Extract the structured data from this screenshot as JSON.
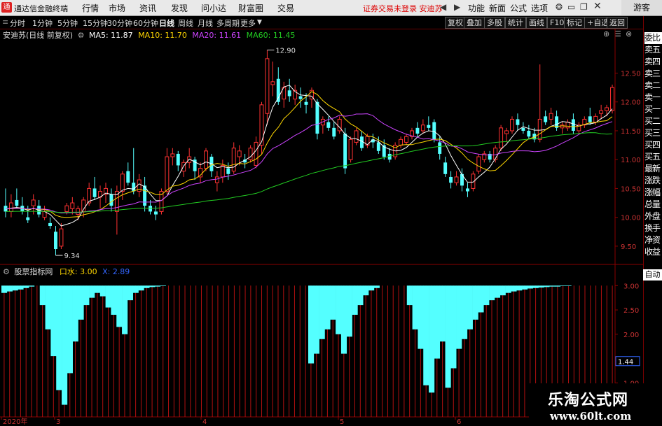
{
  "window": {
    "app_title": "通达信金融终端",
    "logo_glyph": "通",
    "guest": "游客"
  },
  "menu": [
    "行情",
    "市场",
    "资讯",
    "发现",
    "问小达",
    "财富圈",
    "交易"
  ],
  "notice": "证券交易未登录  安迪苏",
  "right_links": [
    "功能",
    "新面",
    "公式",
    "选项"
  ],
  "timeframes": [
    "分时",
    "1分钟",
    "5分钟",
    "15分钟",
    "30分钟",
    "60分钟",
    "日线",
    "周线",
    "月线",
    "多周期",
    "更多"
  ],
  "timeframe_active": "日线",
  "toolbar_buttons": [
    "复权",
    "叠加",
    "多股",
    "统计",
    "画线",
    "F10",
    "标记",
    "+自选",
    "返回"
  ],
  "price_legend": {
    "name": "安迪苏(日线 前复权)",
    "ma5": "MA5: 11.87",
    "ma10": "MA10: 11.70",
    "ma20": "MA20: 11.61",
    "ma60": "MA60: 11.45"
  },
  "indicator_legend": {
    "name": "股票指标网",
    "kou": "口水: 3.00",
    "x": "X: 2.89"
  },
  "right_panel": [
    "委比",
    "卖五",
    "卖四",
    "卖三",
    "卖二",
    "卖一",
    "买一",
    "买二",
    "买三",
    "买四",
    "买五",
    "最新",
    "涨跌",
    "涨幅",
    "总量",
    "外盘",
    "换手",
    "净资",
    "收益"
  ],
  "right_panel_auto": "自动",
  "current_value": "1.44",
  "colors": {
    "up": "#ff3232",
    "down": "#54ffff",
    "ma5": "#ffffff",
    "ma10": "#ffd700",
    "ma20": "#cc44ff",
    "ma60": "#22cc22",
    "grid": "#8a0000",
    "indicator": "#54ffff"
  },
  "watermark": {
    "cn": "乐淘公式网",
    "en": "www.60lt.com"
  },
  "chart_data": [
    {
      "type": "candlestick",
      "y_ticks": [
        9.5,
        10.0,
        10.5,
        11.0,
        11.5,
        12.0,
        12.5
      ],
      "ylim": [
        9.22,
        13.1
      ],
      "high_label": "12.90",
      "low_label": "9.34",
      "x_tick_labels": [
        "2020年",
        "3",
        "4",
        "5",
        "6"
      ],
      "candles": [
        [
          10.2,
          10.5,
          10.0,
          10.1
        ],
        [
          10.1,
          10.4,
          10.0,
          10.25
        ],
        [
          10.3,
          10.5,
          10.15,
          10.2
        ],
        [
          10.2,
          10.35,
          10.05,
          10.1
        ],
        [
          10.0,
          10.2,
          9.9,
          9.95
        ],
        [
          10.2,
          10.4,
          10.05,
          10.3
        ],
        [
          10.2,
          10.3,
          10.0,
          10.05
        ],
        [
          10.0,
          10.2,
          9.95,
          10.1
        ],
        [
          9.9,
          10.0,
          9.8,
          9.85
        ],
        [
          9.75,
          9.85,
          9.34,
          9.45
        ],
        [
          9.5,
          9.9,
          9.45,
          9.8
        ],
        [
          10.1,
          10.25,
          10.05,
          10.2
        ],
        [
          10.15,
          10.35,
          10.05,
          10.25
        ],
        [
          10.05,
          10.2,
          9.95,
          10.15
        ],
        [
          10.1,
          10.35,
          10.0,
          10.3
        ],
        [
          10.25,
          10.6,
          10.2,
          10.5
        ],
        [
          10.5,
          10.7,
          10.3,
          10.35
        ],
        [
          10.35,
          10.55,
          10.15,
          10.45
        ],
        [
          10.4,
          10.6,
          10.25,
          10.5
        ],
        [
          10.4,
          10.5,
          10.1,
          10.2
        ],
        [
          10.1,
          10.55,
          9.7,
          10.45
        ],
        [
          10.45,
          10.8,
          10.3,
          10.75
        ],
        [
          10.8,
          10.95,
          10.55,
          10.6
        ],
        [
          10.6,
          11.2,
          10.4,
          10.45
        ],
        [
          10.45,
          10.75,
          10.35,
          10.65
        ],
        [
          10.55,
          10.7,
          10.1,
          10.2
        ],
        [
          10.2,
          10.3,
          10.05,
          10.1
        ],
        [
          10.1,
          10.2,
          9.95,
          10.05
        ],
        [
          10.1,
          10.5,
          10.05,
          10.45
        ],
        [
          10.45,
          11.2,
          10.4,
          11.05
        ],
        [
          11.05,
          11.2,
          10.9,
          11.1
        ],
        [
          11.1,
          11.15,
          10.8,
          10.9
        ],
        [
          10.8,
          11.0,
          10.7,
          10.95
        ],
        [
          10.95,
          11.2,
          10.85,
          11.05
        ],
        [
          11.0,
          11.05,
          10.65,
          10.8
        ],
        [
          10.7,
          10.95,
          10.6,
          10.85
        ],
        [
          10.85,
          11.2,
          10.8,
          11.15
        ],
        [
          11.05,
          11.1,
          10.7,
          10.8
        ],
        [
          10.6,
          10.8,
          10.45,
          10.7
        ],
        [
          10.7,
          11.0,
          10.6,
          10.9
        ],
        [
          10.85,
          10.95,
          10.65,
          10.75
        ],
        [
          10.8,
          11.3,
          10.75,
          11.2
        ],
        [
          11.05,
          11.25,
          10.9,
          11.15
        ],
        [
          11.0,
          11.1,
          10.85,
          10.95
        ],
        [
          11.0,
          11.25,
          10.95,
          11.2
        ],
        [
          10.9,
          11.4,
          10.85,
          11.3
        ],
        [
          11.25,
          12.0,
          11.1,
          11.95
        ],
        [
          11.8,
          12.9,
          11.6,
          12.75
        ],
        [
          12.3,
          12.7,
          12.1,
          12.35
        ],
        [
          12.4,
          12.6,
          11.95,
          12.0
        ],
        [
          12.05,
          12.35,
          11.9,
          12.25
        ],
        [
          12.2,
          12.4,
          12.0,
          12.1
        ],
        [
          12.05,
          12.3,
          11.95,
          12.2
        ],
        [
          12.1,
          12.25,
          11.9,
          12.05
        ],
        [
          12.0,
          12.15,
          11.8,
          11.95
        ],
        [
          12.05,
          12.25,
          11.9,
          12.2
        ],
        [
          12.0,
          12.05,
          11.35,
          11.45
        ],
        [
          11.6,
          11.75,
          11.45,
          11.7
        ],
        [
          11.65,
          11.75,
          11.5,
          11.55
        ],
        [
          11.55,
          11.65,
          11.35,
          11.4
        ],
        [
          11.5,
          11.75,
          11.45,
          11.7
        ],
        [
          11.45,
          11.55,
          10.75,
          10.85
        ],
        [
          11.0,
          11.4,
          10.95,
          11.35
        ],
        [
          11.3,
          11.55,
          11.25,
          11.5
        ],
        [
          11.4,
          11.5,
          11.15,
          11.2
        ],
        [
          11.25,
          11.45,
          11.2,
          11.4
        ],
        [
          11.35,
          11.45,
          11.2,
          11.3
        ],
        [
          11.3,
          11.4,
          11.1,
          11.15
        ],
        [
          11.25,
          11.35,
          11.0,
          11.05
        ],
        [
          11.1,
          11.2,
          10.95,
          11.0
        ],
        [
          11.05,
          11.3,
          11.0,
          11.25
        ],
        [
          11.25,
          11.4,
          11.2,
          11.35
        ],
        [
          11.3,
          11.45,
          11.25,
          11.4
        ],
        [
          11.4,
          11.55,
          11.35,
          11.5
        ],
        [
          11.55,
          11.65,
          11.4,
          11.45
        ],
        [
          11.5,
          11.7,
          11.45,
          11.6
        ],
        [
          11.6,
          11.75,
          11.5,
          11.55
        ],
        [
          11.65,
          11.7,
          11.3,
          11.35
        ],
        [
          11.3,
          11.4,
          11.0,
          11.1
        ],
        [
          10.95,
          11.05,
          10.7,
          10.75
        ],
        [
          10.7,
          10.8,
          10.5,
          10.6
        ],
        [
          10.6,
          10.8,
          10.55,
          10.7
        ],
        [
          10.75,
          10.85,
          10.45,
          10.55
        ],
        [
          10.5,
          10.6,
          10.35,
          10.45
        ],
        [
          10.5,
          10.8,
          10.45,
          10.75
        ],
        [
          10.8,
          11.1,
          10.75,
          11.05
        ],
        [
          11.0,
          11.15,
          10.95,
          11.1
        ],
        [
          11.1,
          11.15,
          10.95,
          11.0
        ],
        [
          11.0,
          11.25,
          10.95,
          11.2
        ],
        [
          11.2,
          11.6,
          11.15,
          11.55
        ],
        [
          11.45,
          11.55,
          11.3,
          11.5
        ],
        [
          11.5,
          11.75,
          11.45,
          11.7
        ],
        [
          11.7,
          11.8,
          11.5,
          11.6
        ],
        [
          11.55,
          11.65,
          11.45,
          11.5
        ],
        [
          11.5,
          11.6,
          11.35,
          11.4
        ],
        [
          11.45,
          11.55,
          11.3,
          11.35
        ],
        [
          11.35,
          12.65,
          11.3,
          11.7
        ],
        [
          11.75,
          11.85,
          11.6,
          11.65
        ],
        [
          11.7,
          11.9,
          11.6,
          11.8
        ],
        [
          11.75,
          11.85,
          11.5,
          11.55
        ],
        [
          11.55,
          11.65,
          11.45,
          11.6
        ],
        [
          11.55,
          11.7,
          11.5,
          11.65
        ],
        [
          11.7,
          11.8,
          11.45,
          11.5
        ],
        [
          11.5,
          11.65,
          11.45,
          11.6
        ],
        [
          11.6,
          11.75,
          11.55,
          11.7
        ],
        [
          11.75,
          11.9,
          11.6,
          11.65
        ],
        [
          11.65,
          11.8,
          11.6,
          11.75
        ],
        [
          11.8,
          11.95,
          11.7,
          11.85
        ],
        [
          11.85,
          11.95,
          11.75,
          11.9
        ],
        [
          11.85,
          12.3,
          11.8,
          12.25
        ]
      ],
      "ma5_final": 11.87,
      "ma10_final": 11.7,
      "ma20_final": 11.61,
      "ma60_final": 11.45
    },
    {
      "type": "bar",
      "name": "股票指标网",
      "y_ticks": [
        1.0,
        1.5,
        2.0,
        2.5,
        3.0
      ],
      "ylim": [
        0.3,
        3.22
      ],
      "values": [
        2.85,
        2.88,
        2.9,
        2.92,
        2.95,
        2.98,
        3.0,
        2.6,
        2.1,
        1.55,
        0.85,
        0.55,
        1.2,
        1.85,
        2.3,
        2.6,
        2.75,
        2.85,
        2.78,
        2.55,
        2.4,
        2.15,
        2.0,
        2.7,
        2.85,
        2.9,
        2.95,
        2.97,
        2.98,
        2.99,
        3.0,
        3.0,
        3.0,
        3.0,
        3.0,
        3.0,
        3.0,
        3.0,
        3.0,
        3.0,
        3.0,
        3.0,
        3.0,
        3.0,
        3.0,
        3.0,
        3.0,
        3.0,
        3.0,
        3.0,
        3.0,
        3.0,
        3.0,
        3.0,
        3.0,
        3.0,
        1.4,
        1.6,
        1.9,
        2.1,
        2.3,
        2.0,
        1.6,
        1.95,
        2.4,
        2.6,
        2.8,
        2.9,
        2.95,
        3.0,
        3.0,
        3.0,
        3.0,
        3.0,
        2.6,
        2.1,
        1.7,
        0.95,
        0.8,
        1.5,
        1.85,
        0.9,
        1.3,
        1.7,
        1.9,
        2.1,
        2.3,
        2.45,
        2.6,
        2.7,
        2.75,
        2.8,
        2.85,
        2.88,
        2.9,
        2.92,
        2.94,
        2.95,
        2.96,
        2.97,
        2.98,
        2.98,
        2.99,
        2.99,
        3.0,
        3.0,
        3.0,
        3.0,
        3.0,
        3.0,
        3.0,
        3.0
      ]
    }
  ]
}
